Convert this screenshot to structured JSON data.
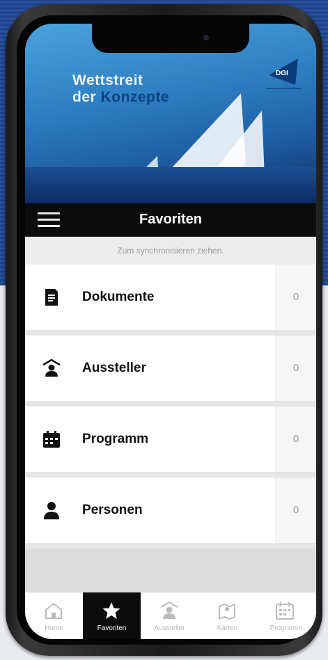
{
  "banner": {
    "line1": "Wettstreit",
    "line2_prefix": "der",
    "line2_highlight": "Konzepte",
    "logo_text": "DGI"
  },
  "navbar": {
    "title": "Favoriten",
    "menu_icon": "hamburger-menu-icon"
  },
  "sync_hint": "Zum synchronisieren ziehen.",
  "favorites": [
    {
      "label": "Dokumente",
      "count": "0",
      "icon": "document-icon"
    },
    {
      "label": "Aussteller",
      "count": "0",
      "icon": "exhibitor-icon"
    },
    {
      "label": "Programm",
      "count": "0",
      "icon": "calendar-icon"
    },
    {
      "label": "Personen",
      "count": "0",
      "icon": "person-icon"
    }
  ],
  "tabs": [
    {
      "label": "Home",
      "icon": "home-icon",
      "active": false
    },
    {
      "label": "Favoriten",
      "icon": "star-icon",
      "active": true
    },
    {
      "label": "Aussteller",
      "icon": "exhibitor-icon",
      "active": false
    },
    {
      "label": "Karten",
      "icon": "map-icon",
      "active": false
    },
    {
      "label": "Programm",
      "icon": "calendar-icon",
      "active": false
    }
  ],
  "colors": {
    "navbar_bg": "#0c0c0c",
    "active_tab_bg": "#0b0b0b",
    "banner_blue": "#2e7fc2"
  }
}
